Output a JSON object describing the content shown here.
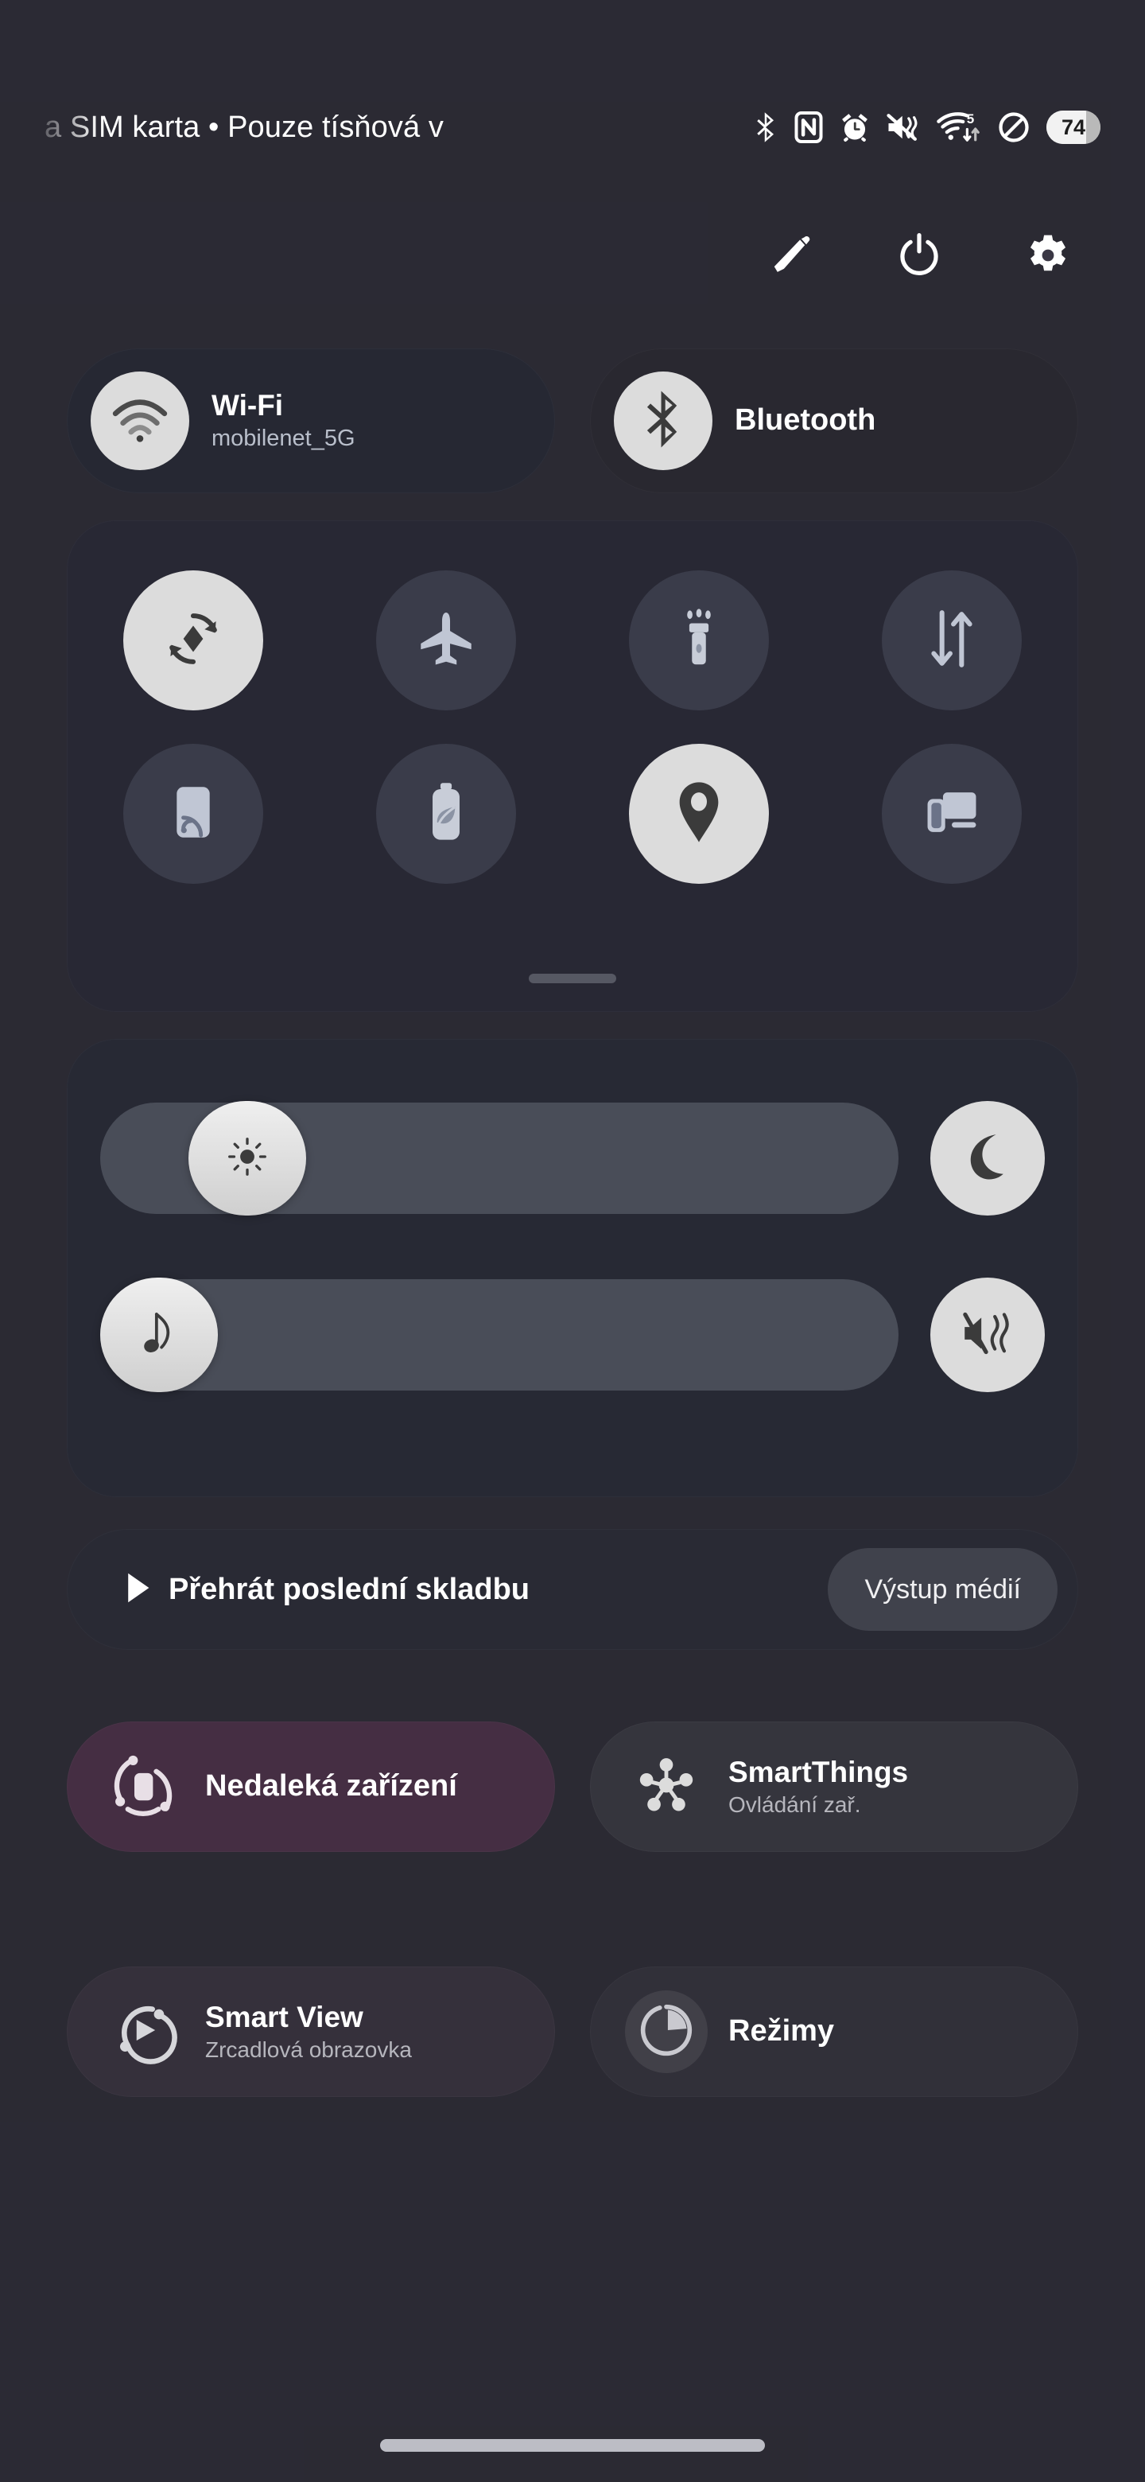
{
  "statusbar": {
    "text": "a SIM karta • Pouze tísňová v",
    "battery_percent": "74",
    "icons": [
      "bluetooth-icon",
      "nfc-icon",
      "alarm-icon",
      "mute-vibrate-icon",
      "wifi-5-data-icon",
      "do-not-disturb-icon",
      "battery-icon"
    ]
  },
  "header": {
    "edit_label": "Upravit",
    "power_label": "Vypnout",
    "settings_label": "Nastavení"
  },
  "connectivity": [
    {
      "title": "Wi-Fi",
      "subtitle": "mobilenet_5G",
      "icon": "wifi-icon",
      "active": true
    },
    {
      "title": "Bluetooth",
      "subtitle": "",
      "icon": "bluetooth-icon",
      "active": true
    }
  ],
  "toggles": [
    {
      "name": "auto-rotate",
      "icon": "auto-rotate-icon",
      "active": true
    },
    {
      "name": "airplane-mode",
      "icon": "airplane-icon",
      "active": false
    },
    {
      "name": "flashlight",
      "icon": "flashlight-icon",
      "active": false
    },
    {
      "name": "mobile-data",
      "icon": "data-arrows-icon",
      "active": false
    },
    {
      "name": "mobile-hotspot",
      "icon": "hotspot-icon",
      "active": false
    },
    {
      "name": "power-saving",
      "icon": "battery-leaf-icon",
      "active": false
    },
    {
      "name": "location",
      "icon": "location-pin-icon",
      "active": true
    },
    {
      "name": "dex",
      "icon": "dex-icon",
      "active": false
    }
  ],
  "sliders": [
    {
      "name": "brightness",
      "icon": "brightness-icon",
      "value": 13,
      "side_button": "dark-mode-moon-icon"
    },
    {
      "name": "volume",
      "icon": "music-note-icon",
      "value": 0,
      "side_button": "vibrate-mute-icon"
    }
  ],
  "media": {
    "label": "Přehrát poslední skladbu",
    "play_icon": "play-icon",
    "output_button": "Výstup médií"
  },
  "features": [
    {
      "title": "Nedaleká zařízení",
      "subtitle": "",
      "icon": "quick-share-icon"
    },
    {
      "title": "SmartThings",
      "subtitle": "Ovládání zař.",
      "icon": "smartthings-icon"
    },
    {
      "title": "Smart View",
      "subtitle": "Zrcadlová obrazovka",
      "icon": "smart-view-icon"
    },
    {
      "title": "Režimy",
      "subtitle": "",
      "icon": "modes-pie-icon"
    }
  ],
  "colors": {
    "accent_light": "#dcdcdc",
    "text_primary": "#ffffff",
    "text_secondary": "#b9bfcb"
  }
}
